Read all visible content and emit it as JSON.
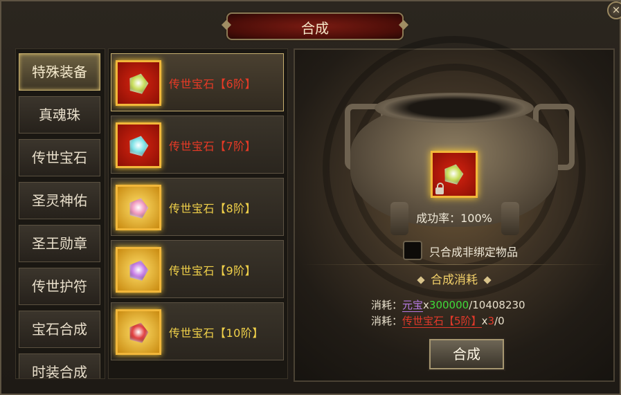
{
  "window": {
    "title": "合成",
    "close_label": "×"
  },
  "categories": [
    {
      "label": "特殊装备",
      "active": true
    },
    {
      "label": "真魂珠",
      "active": false
    },
    {
      "label": "传世宝石",
      "active": false
    },
    {
      "label": "圣灵神佑",
      "active": false
    },
    {
      "label": "圣王勋章",
      "active": false
    },
    {
      "label": "传世护符",
      "active": false
    },
    {
      "label": "宝石合成",
      "active": false
    },
    {
      "label": "时装合成",
      "active": false
    }
  ],
  "items": [
    {
      "name": "传世宝石【6阶】",
      "frame": "red",
      "gem_color": "#c8de5a",
      "active": true
    },
    {
      "name": "传世宝石【7阶】",
      "frame": "red",
      "gem_color": "#7fe4e8",
      "active": false
    },
    {
      "name": "传世宝石【8阶】",
      "frame": "gold",
      "gem_color": "#f29ac0",
      "active": false
    },
    {
      "name": "传世宝石【9阶】",
      "frame": "gold",
      "gem_color": "#c77ee8",
      "active": false
    },
    {
      "name": "传世宝石【10阶】",
      "frame": "gold",
      "gem_color": "#e24040",
      "active": false
    }
  ],
  "result": {
    "gem_color": "#c8de5a",
    "success_rate": "成功率：100%",
    "only_unbound_label": "只合成非绑定物品",
    "only_unbound_checked": false
  },
  "cost": {
    "header": "合成消耗",
    "prefix": "消耗：",
    "lines": [
      {
        "name": "元宝",
        "x": "x",
        "need": "300000",
        "sep": "/",
        "have": "10408230"
      },
      {
        "name": "传世宝石【5阶】",
        "x": "x",
        "need": "3",
        "sep": "/",
        "have": "0"
      }
    ]
  },
  "craft_button": "合成",
  "colors": {
    "accent_gold": "#f2b73a",
    "name_red": "#ea3a26",
    "name_gold": "#f2d24a",
    "ok_green": "#3fdc3a"
  }
}
